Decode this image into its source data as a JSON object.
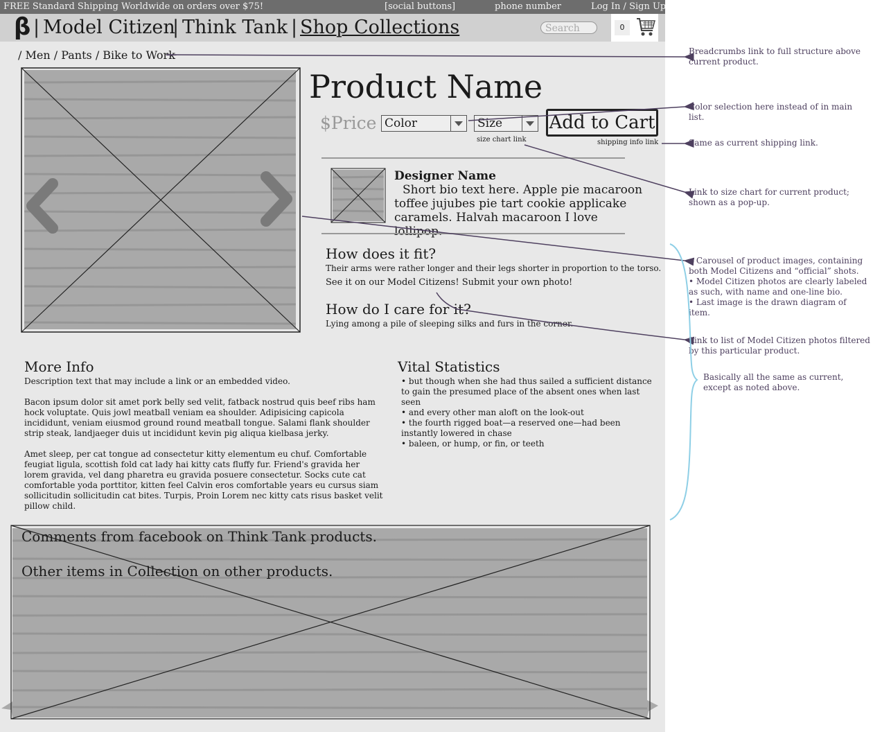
{
  "topbar": {
    "free_shipping": "FREE Standard Shipping Worldwide on orders over $75!",
    "social": "[social buttons]",
    "phone": "phone number",
    "login": "Log In / Sign Up"
  },
  "header": {
    "logo": "β",
    "sep": "|",
    "nav": [
      "Model Citizen",
      "Think Tank",
      "Shop Collections"
    ],
    "search_placeholder": "Search",
    "cart_count": "0"
  },
  "breadcrumb": "/ Men / Pants / Bike to Work",
  "product": {
    "name": "Product Name",
    "price": "$Price",
    "color_select": "Color",
    "size_select": "Size",
    "add_to_cart": "Add to Cart",
    "size_chart_link": "size chart link",
    "shipping_info_link": "shipping info link"
  },
  "designer": {
    "name": "Designer Name",
    "bio": "Short bio text here. Apple pie macaroon toffee jujubes pie tart cookie applicake caramels. Halvah macaroon I love lollipop."
  },
  "fit": {
    "heading": "How does it fit?",
    "text": "Their arms were rather longer and their legs shorter in proportion to the torso.",
    "link": "See it on our Model Citizens! Submit your own photo!"
  },
  "care": {
    "heading": "How do I care for it?",
    "text": "Lying among a pile of sleeping silks and furs in the corner."
  },
  "more_info": {
    "heading": "More Info",
    "p1": "Description text that may include a link or an embedded video.",
    "p2": "Bacon ipsum dolor sit amet pork belly sed velit, fatback nostrud quis beef ribs ham hock voluptate. Quis jowl meatball veniam ea shoulder. Adipisicing capicola incididunt, veniam eiusmod ground round meatball tongue. Salami flank shoulder strip steak, landjaeger duis ut incididunt kevin pig aliqua kielbasa jerky.",
    "p3": "Amet sleep, per cat tongue ad consectetur kitty elementum eu chuf. Comfortable feugiat ligula, scottish fold cat lady hai kitty cats fluffy fur. Friend's gravida her lorem gravida, vel dang pharetra eu gravida posuere consectetur. Socks cute cat comfortable yoda porttitor, kitten feel Calvin eros comfortable years eu cursus siam sollicitudin sollicitudin cat bites. Turpis, Proin Lorem nec kitty cats risus basket velit pillow child."
  },
  "vital_stats": {
    "heading": "Vital Statistics",
    "items": [
      "• but though when she had thus sailed a sufficient distance to gain the presumed place of the absent ones when last seen",
      "• and every other man aloft on the look-out",
      "• the fourth rigged boat—a reserved one—had been instantly lowered in chase",
      "• baleen, or hump, or fin, or teeth"
    ]
  },
  "bottom": {
    "comments": "Comments from facebook on Think Tank products.",
    "other_items": "Other items in Collection on other products."
  },
  "annotations": {
    "breadcrumbs": "Breadcrumbs link to full structure above current product.",
    "color": "Color selection here instead of in main list.",
    "shipping": "Same as current shipping link.",
    "size_chart": "Link to size chart for current product; shown as a pop-up.",
    "carousel": "• Carousel of product images, containing both Model Citizens and “official” shots.\n• Model Citizen photos are clearly labeled as such, with name and one-line bio.\n• Last image is the drawn diagram of item.",
    "model_citizen": "Link to list of Model Citizen photos filtered by this particular product.",
    "same": "Basically all the same as current, except as noted above."
  },
  "colors": {
    "topbar": "#6d6d6d",
    "header": "#d0d0d0",
    "page": "#e8e8e8",
    "annotation": "#4e405f",
    "bracket": "#8ecfe6"
  }
}
